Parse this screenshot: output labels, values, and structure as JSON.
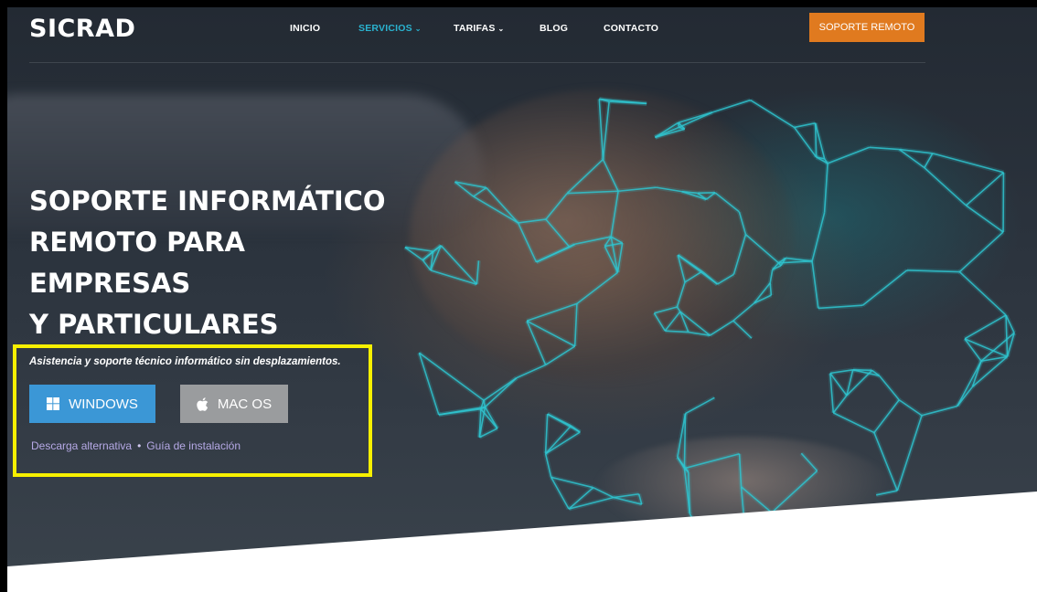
{
  "brand": {
    "logo": "SICRAD"
  },
  "nav": {
    "items": [
      {
        "label": "INICIO",
        "active": false,
        "dropdown": false
      },
      {
        "label": "SERVICIOS",
        "active": true,
        "dropdown": true
      },
      {
        "label": "TARIFAS",
        "active": false,
        "dropdown": true
      },
      {
        "label": "BLOG",
        "active": false,
        "dropdown": false
      },
      {
        "label": "CONTACTO",
        "active": false,
        "dropdown": false
      }
    ],
    "cta_label": "SOPORTE REMOTO"
  },
  "hero": {
    "title_lines": [
      "SOPORTE INFORMÁTICO",
      "REMOTO PARA",
      "EMPRESAS",
      "Y PARTICULARES"
    ],
    "subtitle": "Asistencia y soporte técnico informático sin desplazamientos.",
    "buttons": {
      "windows": {
        "label": "WINDOWS",
        "icon": "windows-icon"
      },
      "mac": {
        "label": "MAC OS",
        "icon": "apple-icon"
      }
    },
    "links": {
      "alt_download": "Descarga alternativa",
      "separator": "•",
      "install_guide": "Guía de instalación"
    }
  },
  "colors": {
    "accent": "#2ab3d0",
    "cta": "#e07a1f",
    "windows_button": "#3b97d6",
    "mac_button": "#9a9c9e",
    "highlight": "#f7f000",
    "link": "#b6a9e6"
  }
}
